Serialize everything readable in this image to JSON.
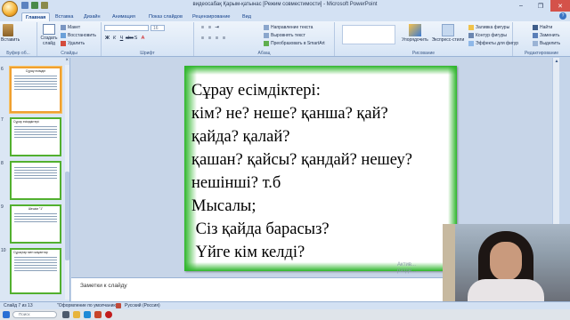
{
  "window": {
    "title": "видеосабақ Қарым-қатынас [Режим совместимости] - Microsoft PowerPoint",
    "minimize": "–",
    "maximize": "❐",
    "close": "✕"
  },
  "tabs": [
    {
      "label": "Главная"
    },
    {
      "label": "Вставка"
    },
    {
      "label": "Дизайн"
    },
    {
      "label": "Анимация"
    },
    {
      "label": "Показ слайдов"
    },
    {
      "label": "Рецензирование"
    },
    {
      "label": "Вид"
    }
  ],
  "ribbon": {
    "clipboard": {
      "paste": "Вставить",
      "cut": "Макет",
      "copy": "Восстановить",
      "delete": "Удалить",
      "label": "Буфер об..."
    },
    "slides": {
      "new_slide_line1": "Создать",
      "new_slide_line2": "слайд",
      "label": "Слайды"
    },
    "font": {
      "font_name": "",
      "font_size": "16",
      "label": "Шрифт"
    },
    "paragraph": {
      "text_direction": "Направление текста",
      "align_text": "Выровнять текст",
      "smartart": "Преобразовать в SmartArt",
      "label": "Абзац"
    },
    "drawing": {
      "arrange": "Упорядочить",
      "quick_styles": "Экспресс-стили",
      "fill": "Заливка фигуры",
      "outline": "Контур фигуры",
      "effects": "Эффекты для фигур",
      "label": "Рисование"
    },
    "editing": {
      "find": "Найти",
      "replace": "Заменить",
      "select": "Выделить",
      "label": "Редактирование"
    }
  },
  "thumbnails": [
    {
      "num": "6",
      "title": "Сұрау есімдігі",
      "selected": true
    },
    {
      "num": "7",
      "title": "Сұрау есімдіктері:",
      "selected": false
    },
    {
      "num": "8",
      "title": "",
      "selected": false
    },
    {
      "num": "9",
      "title": "Шешім \"1\"",
      "selected": false
    },
    {
      "num": "10",
      "title": "Сұрақтар мен жауаптар",
      "selected": false
    }
  ],
  "slide": {
    "lines": [
      "Сұрау есімдіктері:",
      "кім? не? неше?  қанша? қай?",
      "қайда? қалай?",
      "қашан? қайсы? қандай? нешеу?",
      "нешінші? т.б",
      "Мысалы;",
      " Сіз қайда барасыз?",
      " Үйге кім келді?"
    ]
  },
  "notes": {
    "placeholder": "Заметки к слайду"
  },
  "activation": {
    "line1": "Актив...",
    "line2": "разде..."
  },
  "status": {
    "slide_info": "Слайд 7 из 13",
    "theme": "\"Оформление по умолчанию\"",
    "language": "Русский (Россия)"
  },
  "taskbar": {
    "search": "Поиск",
    "time": "",
    "date": ""
  },
  "colors": {
    "accent": "#2db52a",
    "ribbon": "#d6e4f5",
    "selected_thumb": "#f0a030"
  }
}
